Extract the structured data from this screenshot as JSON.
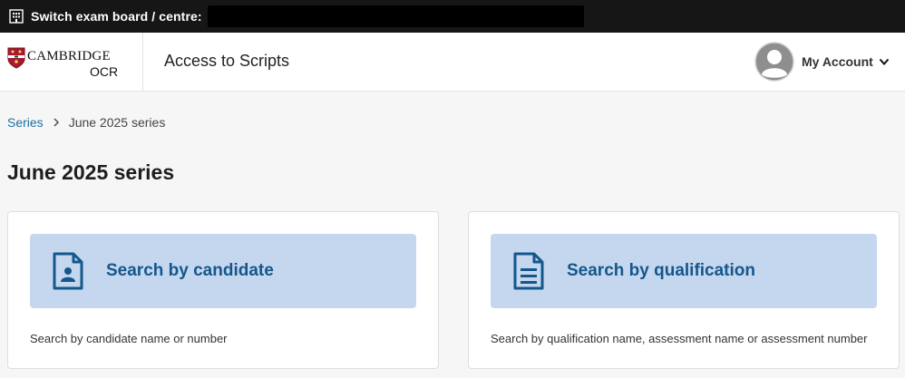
{
  "topbar": {
    "switch_label": "Switch exam board / centre:",
    "building_icon": "building-icon"
  },
  "header": {
    "logo_brand": "CAMBRIDGE",
    "logo_sub": "OCR",
    "app_title": "Access to Scripts",
    "account_label": "My Account",
    "avatar_icon": "user-avatar-icon",
    "chevron_icon": "chevron-down-icon"
  },
  "breadcrumb": {
    "items": [
      {
        "label": "Series"
      },
      {
        "label": "June 2025 series"
      }
    ]
  },
  "page": {
    "title": "June 2025 series"
  },
  "cards": [
    {
      "label": "Search by candidate",
      "description": "Search by candidate name or number",
      "icon": "candidate-document-icon"
    },
    {
      "label": "Search by qualification",
      "description": "Search by qualification name, assessment name or assessment number",
      "icon": "qualification-document-icon"
    }
  ],
  "colors": {
    "topbar_bg": "#161616",
    "action_bg": "#c5d7ee",
    "action_text": "#14578c",
    "link": "#1d6fa9"
  }
}
